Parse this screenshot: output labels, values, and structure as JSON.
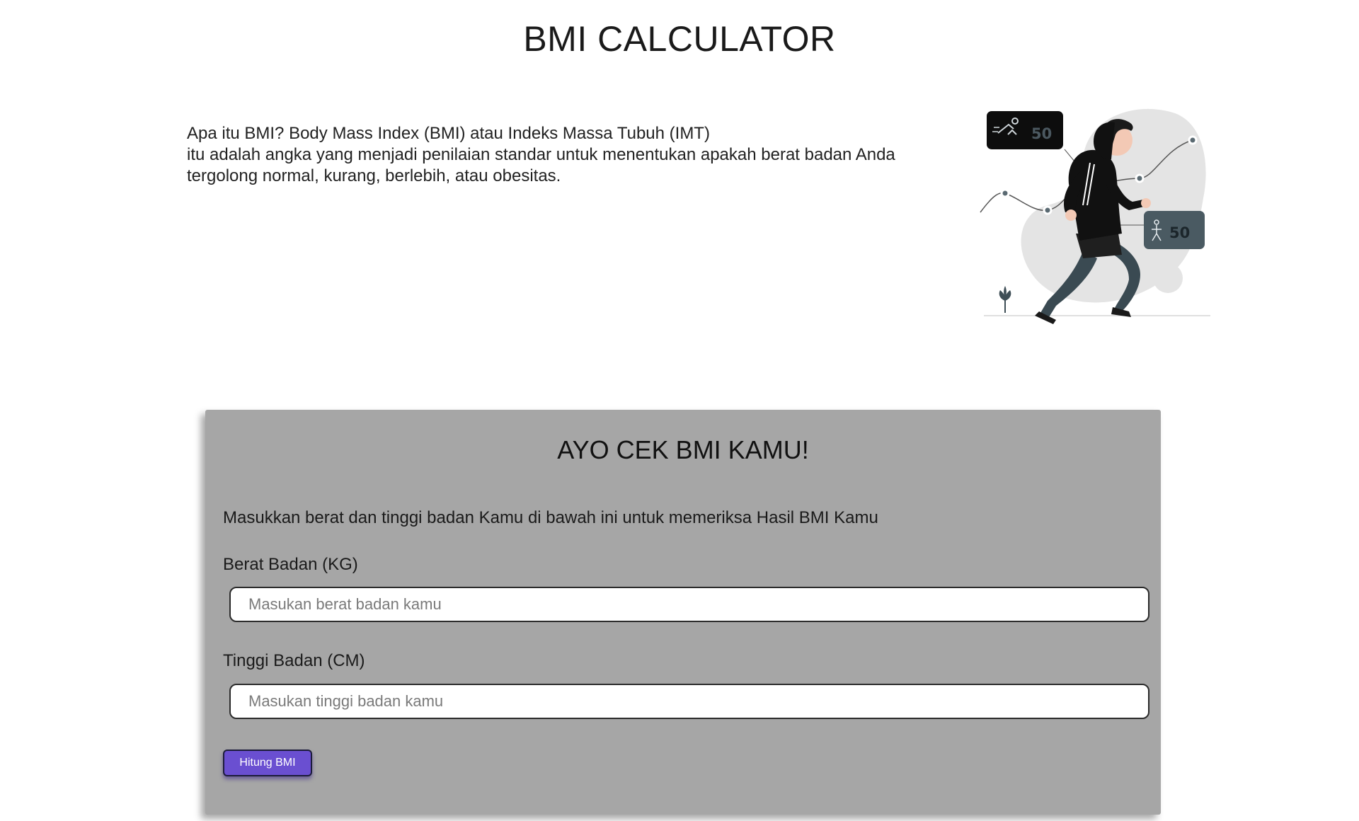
{
  "page": {
    "title": "BMI CALCULATOR"
  },
  "intro": {
    "lines": [
      "Apa itu BMI? Body Mass Index (BMI) atau Indeks Massa Tubuh (IMT)",
      "itu adalah angka yang menjadi penilaian standar untuk menentukan apakah berat badan Anda",
      "tergolong normal, kurang, berlebih, atau obesitas."
    ]
  },
  "illustration": {
    "badge_top_value": "50",
    "badge_right_value": "50"
  },
  "form": {
    "heading": "AYO CEK BMI KAMU!",
    "description": "Masukkan berat dan tinggi badan Kamu di bawah ini untuk memeriksa Hasil BMI Kamu",
    "weight": {
      "label": "Berat Badan (KG)",
      "placeholder": "Masukan berat badan kamu",
      "value": ""
    },
    "height": {
      "label": "Tinggi Badan (CM)",
      "placeholder": "Masukan tinggi badan kamu",
      "value": ""
    },
    "submit_label": "Hitung BMI"
  },
  "colors": {
    "card_background": "#a6a6a6",
    "button_background": "#6a4fd1",
    "badge_dark": "#111111",
    "badge_slate": "#4a5a62"
  }
}
